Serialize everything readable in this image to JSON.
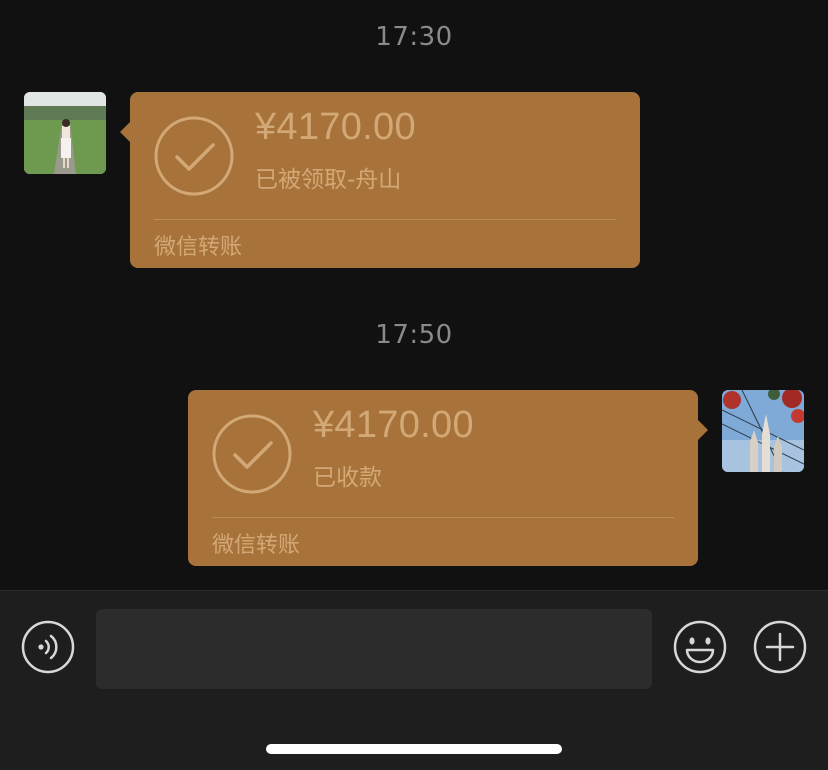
{
  "chat": {
    "messages": [
      {
        "time": "17:30",
        "sender": "contact",
        "amount": "¥4170.00",
        "status": "已被领取-舟山",
        "footer": "微信转账",
        "icon": "check-circle-icon"
      },
      {
        "time": "17:50",
        "sender": "self",
        "amount": "¥4170.00",
        "status": "已收款",
        "footer": "微信转账",
        "icon": "check-circle-icon"
      }
    ]
  },
  "input_bar": {
    "message_value": "",
    "icons": [
      "voice-icon",
      "emoji-icon",
      "plus-icon"
    ]
  },
  "colors": {
    "background": "#111111",
    "bubble": "#a8733a",
    "bubble_text": "#d2a877",
    "timestamp_text": "#8a8a8a",
    "input_bar": "#1e1e1e"
  }
}
